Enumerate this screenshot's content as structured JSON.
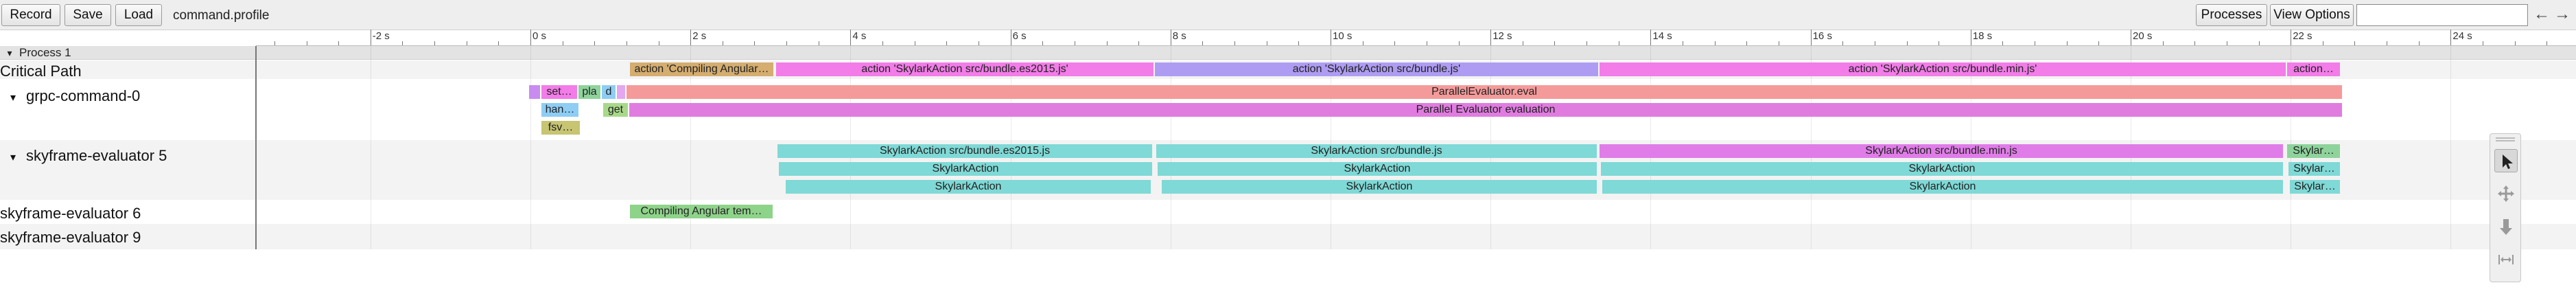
{
  "toolbar": {
    "record_label": "Record",
    "save_label": "Save",
    "load_label": "Load",
    "file_name": "command.profile",
    "processes_label": "Processes",
    "view_options_label": "View Options",
    "search_value": "",
    "nav_prev": "←",
    "nav_next": "→"
  },
  "ruler": {
    "labels": [
      "-2 s",
      "0 s",
      "2 s",
      "4 s",
      "6 s",
      "8 s",
      "10 s",
      "12 s",
      "14 s",
      "16 s",
      "18 s",
      "20 s",
      "22 s",
      "24 s"
    ]
  },
  "process": {
    "toggle": "▾",
    "label": "Process 1"
  },
  "rows": [
    {
      "label": "Critical Path",
      "toggle": ""
    },
    {
      "label": "grpc-command-0",
      "toggle": "▾"
    },
    {
      "label": "skyframe-evaluator 5",
      "toggle": "▾"
    },
    {
      "label": "skyframe-evaluator 6",
      "toggle": ""
    },
    {
      "label": "skyframe-evaluator 9",
      "toggle": ""
    }
  ],
  "slices": [
    {
      "text": "action 'Compiling Angular…",
      "color": "#d4ad6f"
    },
    {
      "text": "action 'SkylarkAction src/bundle.es2015.js'",
      "color": "#f27ce8"
    },
    {
      "text": "action 'SkylarkAction src/bundle.js'",
      "color": "#ae9cf2"
    },
    {
      "text": "action 'SkylarkAction src/bundle.min.js'",
      "color": "#f27ce8"
    },
    {
      "text": "action…",
      "color": "#f27ce8"
    },
    {
      "text": "",
      "color": "#c88cf0"
    },
    {
      "text": "set…",
      "color": "#f27ce8"
    },
    {
      "text": "pla",
      "color": "#8ed39b"
    },
    {
      "text": "d",
      "color": "#8ecdf4"
    },
    {
      "text": "",
      "color": "#e4a6f0"
    },
    {
      "text": "ParallelEvaluator.eval",
      "color": "#f59a9a"
    },
    {
      "text": "han…",
      "color": "#8ecdf4"
    },
    {
      "text": "get",
      "color": "#a8d98a"
    },
    {
      "text": "Parallel Evaluator evaluation",
      "color": "#e07ce0"
    },
    {
      "text": "fsv…",
      "color": "#c7c472"
    },
    {
      "text": "SkylarkAction src/bundle.es2015.js",
      "color": "#7fd9d6"
    },
    {
      "text": "SkylarkAction src/bundle.js",
      "color": "#7fd9d6"
    },
    {
      "text": "SkylarkAction src/bundle.min.js",
      "color": "#e07ce8"
    },
    {
      "text": "Skylar…",
      "color": "#8ed39b"
    },
    {
      "text": "SkylarkAction",
      "color": "#7fd9d6"
    },
    {
      "text": "SkylarkAction",
      "color": "#7fd9d6"
    },
    {
      "text": "SkylarkAction",
      "color": "#7fd9d6"
    },
    {
      "text": "Skylar…",
      "color": "#7fd9d6"
    },
    {
      "text": "SkylarkAction",
      "color": "#7fd9d6"
    },
    {
      "text": "SkylarkAction",
      "color": "#7fd9d6"
    },
    {
      "text": "SkylarkAction",
      "color": "#7fd9d6"
    },
    {
      "text": "Skylar…",
      "color": "#7fd9d6"
    },
    {
      "text": "Compiling Angular tem…",
      "color": "#8ed38a"
    }
  ],
  "mouse_modes": [
    {
      "icon": "pointer-icon",
      "active": true
    },
    {
      "icon": "pan-icon",
      "active": false
    },
    {
      "icon": "zoom-icon",
      "active": false
    },
    {
      "icon": "timing-icon",
      "active": false
    }
  ]
}
